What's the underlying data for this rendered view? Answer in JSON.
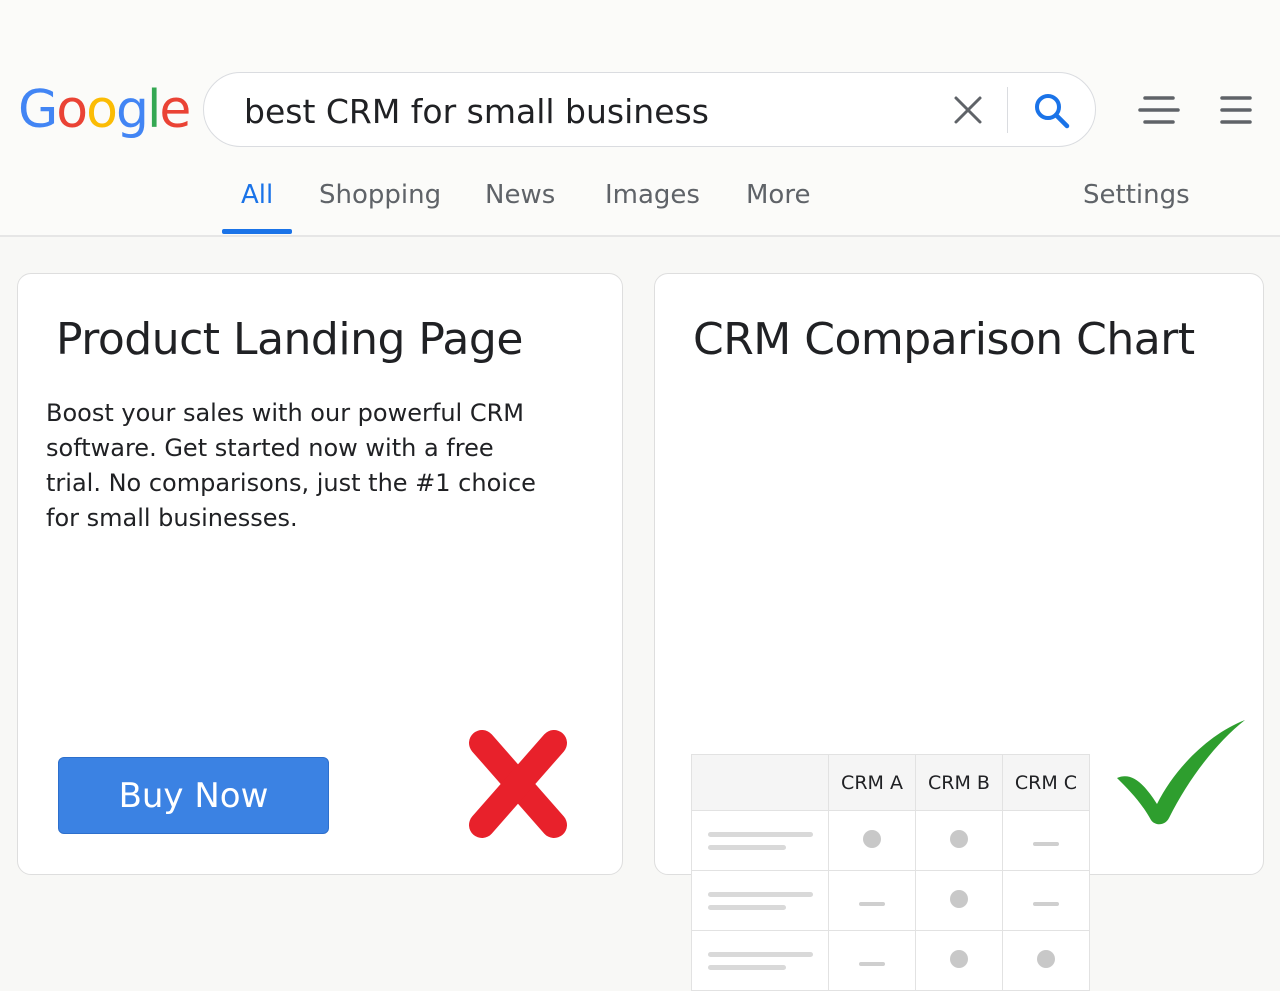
{
  "logo": {
    "letters": [
      "G",
      "o",
      "o",
      "g",
      "l",
      "e"
    ],
    "colors": [
      "#4285F4",
      "#EA4335",
      "#FBBC05",
      "#4285F4",
      "#34A853",
      "#EA4335"
    ]
  },
  "search": {
    "query": "best CRM for small business"
  },
  "tabs": [
    {
      "label": "All",
      "active": true
    },
    {
      "label": "Shopping",
      "active": false
    },
    {
      "label": "News",
      "active": false
    },
    {
      "label": "Images",
      "active": false
    },
    {
      "label": "More",
      "active": false
    }
  ],
  "settings_label": "Settings",
  "left_card": {
    "title": "Product Landing Page",
    "description": "Boost your sales with our powerful CRM software. Get started now with a free trial. No comparisons, just the #1 choice for small businesses.",
    "button_label": "Buy Now",
    "mark_icon": "red-cross-icon"
  },
  "right_card": {
    "title": "CRM Comparison Chart",
    "mark_icon": "green-check-icon",
    "table": {
      "columns": [
        "CRM A",
        "CRM B",
        "CRM C"
      ],
      "rows": [
        [
          "dot",
          "dot",
          "dash"
        ],
        [
          "dash",
          "dot",
          "dash"
        ],
        [
          "dash",
          "dot",
          "dot"
        ]
      ]
    }
  },
  "colors": {
    "accent": "#1a73e8",
    "button": "#3b82e3",
    "cross": "#e8212b",
    "check": "#2e9e2e"
  }
}
